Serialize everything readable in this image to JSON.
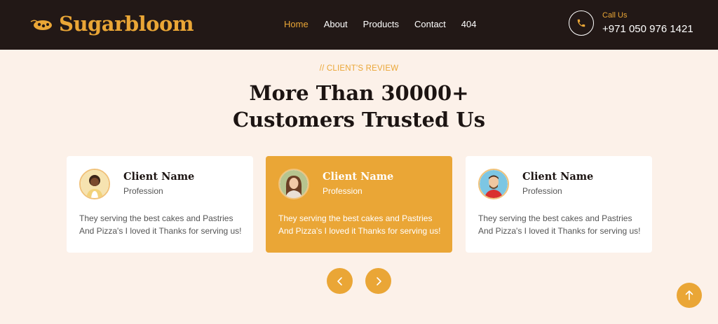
{
  "brand": {
    "name": "Sugarbloom",
    "icon": "pastry-logo-icon"
  },
  "nav": {
    "items": [
      {
        "label": "Home",
        "active": true
      },
      {
        "label": "About",
        "active": false
      },
      {
        "label": "Products",
        "active": false
      },
      {
        "label": "Contact",
        "active": false
      },
      {
        "label": "404",
        "active": false
      }
    ]
  },
  "call": {
    "label": "Call Us",
    "number": "+971 050 976 1421",
    "icon": "phone-icon"
  },
  "section": {
    "eyebrow": "// CLIENT'S REVIEW",
    "title_line1": "More Than 30000+",
    "title_line2": "Customers Trusted Us"
  },
  "reviews": [
    {
      "name": "Client Name",
      "profession": "Profession",
      "text": "They serving the best cakes and Pastries And Pizza's I loved it Thanks for serving us!",
      "featured": false
    },
    {
      "name": "Client Name",
      "profession": "Profession",
      "text": "They serving the best cakes and Pastries And Pizza's I loved it Thanks for serving us!",
      "featured": true
    },
    {
      "name": "Client Name",
      "profession": "Profession",
      "text": "They serving the best cakes and Pastries And Pizza's I loved it Thanks for serving us!",
      "featured": false
    }
  ],
  "carousel": {
    "prev_icon": "chevron-left-icon",
    "next_icon": "chevron-right-icon"
  },
  "back_to_top": {
    "icon": "arrow-up-icon"
  },
  "colors": {
    "accent": "#eaa636",
    "nav_bg": "#221816",
    "page_bg": "#fcf1e9",
    "heading": "#1c1412"
  }
}
